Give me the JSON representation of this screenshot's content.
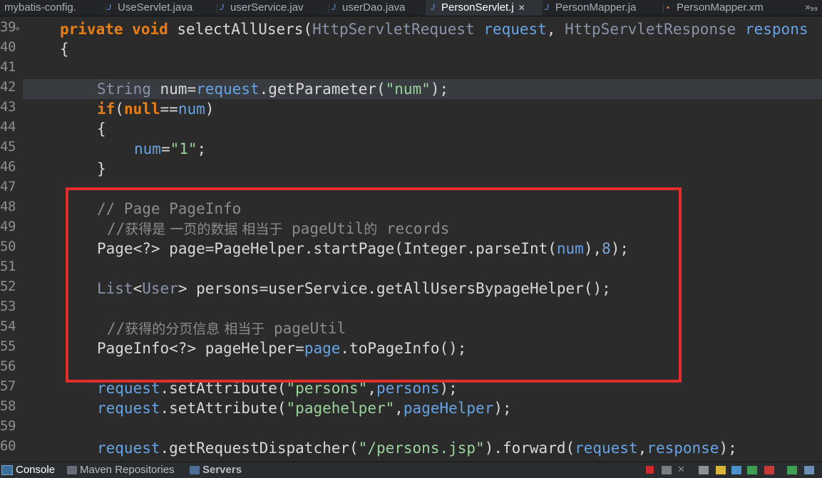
{
  "tabs": [
    {
      "label": "mybatis-config.",
      "icon": "xml-file-icon",
      "active": false
    },
    {
      "label": "UseServlet.java",
      "icon": "java-file-icon",
      "active": false
    },
    {
      "label": "userService.jav",
      "icon": "java-file-icon",
      "active": false
    },
    {
      "label": "userDao.java",
      "icon": "java-file-icon",
      "active": false
    },
    {
      "label": "PersonServlet.j",
      "icon": "java-file-icon",
      "active": true
    },
    {
      "label": "PersonMapper.ja",
      "icon": "java-file-icon",
      "active": false
    },
    {
      "label": "PersonMapper.xm",
      "icon": "xml-file-icon",
      "active": false
    }
  ],
  "tab_close_glyph": "✕",
  "tab_overflow_label": "»₉₉",
  "editor": {
    "line_numbers": [
      "39",
      "40",
      "41",
      "42",
      "43",
      "44",
      "45",
      "46",
      "47",
      "48",
      "49",
      "50",
      "51",
      "52",
      "53",
      "54",
      "55",
      "56",
      "57",
      "58",
      "59",
      "60"
    ],
    "highlighted_line": "42",
    "lines": {
      "l39": [
        "private",
        "void",
        "selectAllUsers(",
        "HttpServletRequest",
        "request",
        ", ",
        "HttpServletResponse",
        "respons"
      ],
      "l40": "{",
      "l42": [
        "String",
        "num",
        "=",
        "request",
        ".getParameter(",
        "\"num\"",
        ");"
      ],
      "l43": [
        "if",
        "(",
        "null",
        "==",
        "num",
        ")"
      ],
      "l44": "{",
      "l45": [
        "num",
        "=",
        "\"1\"",
        ";"
      ],
      "l46": "}",
      "l48": "// Page PageInfo",
      "l49": [
        "//",
        "获得是 一页的数据 相当于",
        "pageUtil",
        "的",
        "records"
      ],
      "l50": [
        "Page<?>",
        "page",
        "=",
        "PageHelper",
        ".startPage(",
        "Integer",
        ".parseInt(",
        "num",
        "),",
        "8",
        ");"
      ],
      "l52": [
        "List",
        "<",
        "User",
        ">",
        "persons",
        "=",
        "userService",
        ".getAllUsersBypageHelper();"
      ],
      "l54": [
        "//",
        "获得的分页信息 相当于",
        "pageUtil"
      ],
      "l55": [
        "PageInfo<?>",
        "pageHelper",
        "=",
        "page",
        ".toPageInfo();"
      ],
      "l57": [
        "request",
        ".setAttribute(",
        "\"persons\"",
        ",",
        "persons",
        ");"
      ],
      "l58": [
        "request",
        ".setAttribute(",
        "\"pagehelper\"",
        ",",
        "pageHelper",
        ");"
      ],
      "l60": [
        "request",
        ".getRequestDispatcher(",
        "\"/persons.jsp\"",
        ").forward(",
        "request",
        ",",
        "response",
        ");"
      ]
    }
  },
  "annotation": {
    "color": "#e42c2c"
  },
  "bottom_tabs": [
    {
      "label": "Console",
      "icon": "console-icon",
      "active": true
    },
    {
      "label": "Maven Repositories",
      "icon": "maven-icon",
      "active": false
    },
    {
      "label": "Servers",
      "icon": "servers-icon",
      "active": false
    }
  ],
  "toolbar_icons": [
    "terminate-icon",
    "remove-launch-icon",
    "remove-all-icon",
    "clear-console-icon",
    "scroll-lock-icon",
    "word-wrap-icon",
    "show-on-output-icon",
    "show-on-error-icon",
    "pin-console-icon",
    "display-console-icon"
  ]
}
